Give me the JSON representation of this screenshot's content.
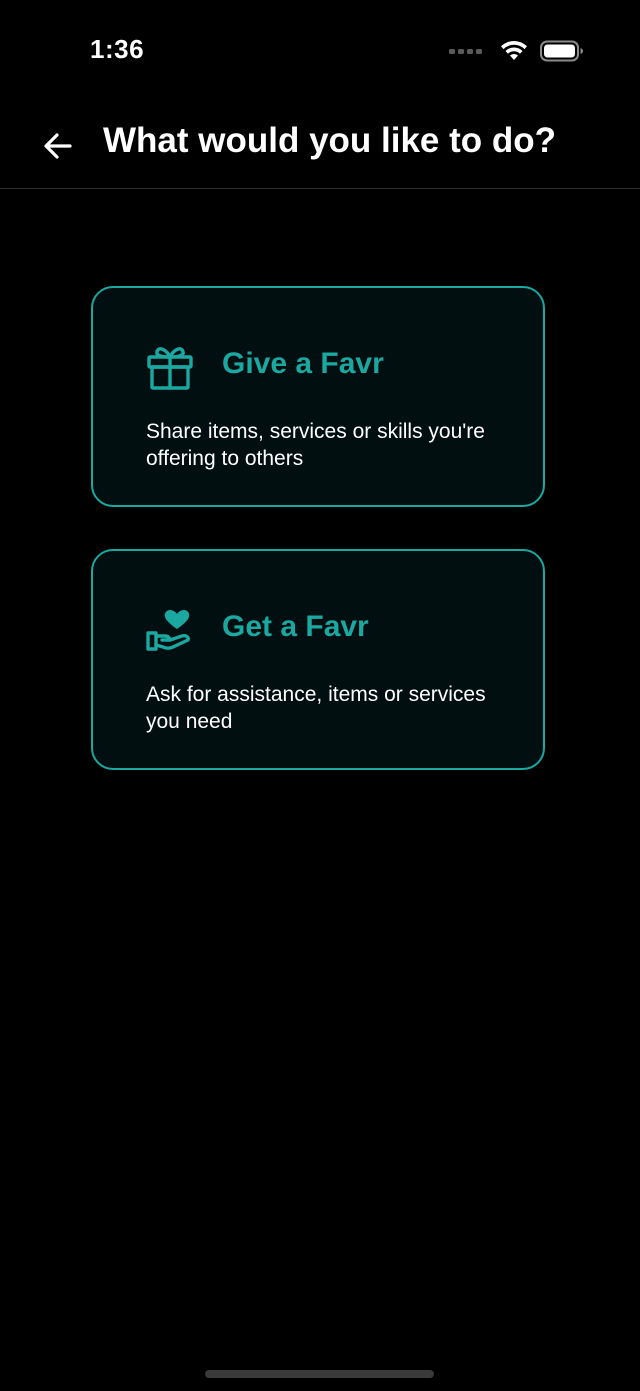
{
  "status_bar": {
    "time": "1:36",
    "icons": [
      "signal-dots-icon",
      "wifi-icon",
      "battery-icon"
    ]
  },
  "header": {
    "title": "What would you like to do?",
    "back_icon": "arrow-left-icon"
  },
  "options": [
    {
      "title": "Give a Favr",
      "description": "Share items, services or skills you're offering to others",
      "icon": "gift-icon"
    },
    {
      "title": "Get a Favr",
      "description": "Ask for assistance, items or services you need",
      "icon": "hand-heart-icon"
    }
  ],
  "colors": {
    "background": "#000000",
    "accent": "#1aa8a0",
    "card_background": "#020f10",
    "text": "#ffffff"
  }
}
